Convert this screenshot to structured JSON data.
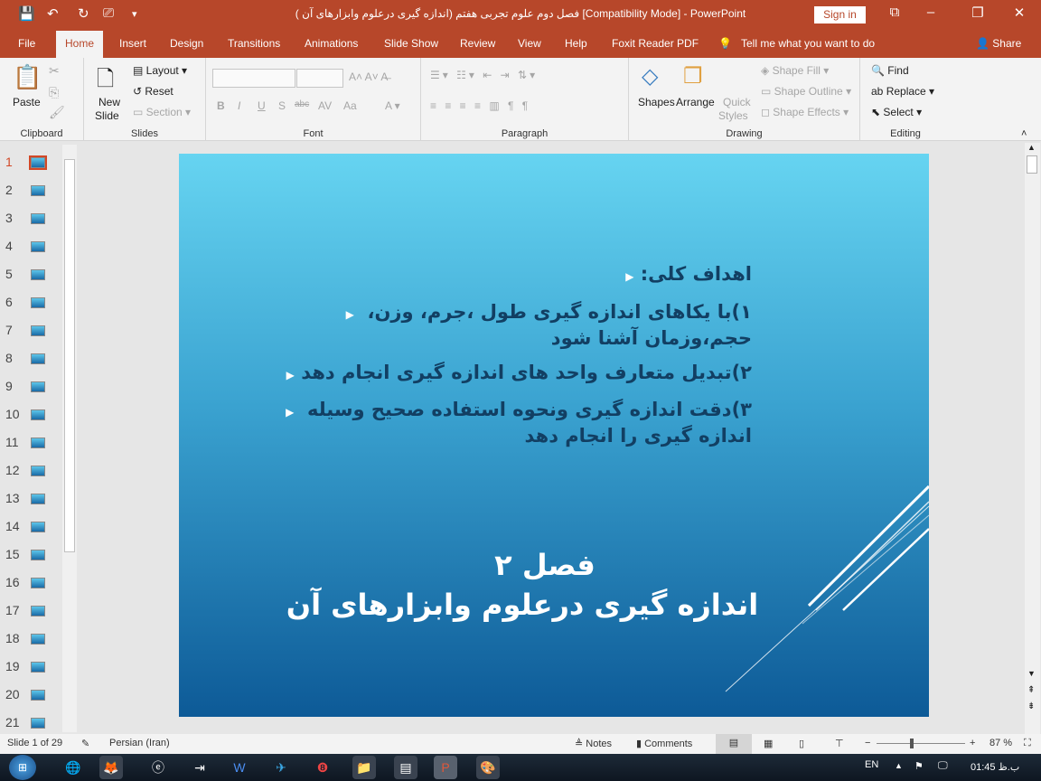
{
  "window": {
    "title": "فصل دوم علوم تجربی هفتم (اندازه گیری درعلوم وابزارهای آن ) [Compatibility Mode]  -  PowerPoint",
    "sign_in": "Sign in"
  },
  "tabs": [
    "File",
    "Home",
    "Insert",
    "Design",
    "Transitions",
    "Animations",
    "Slide Show",
    "Review",
    "View",
    "Help",
    "Foxit Reader PDF"
  ],
  "tell_me": "Tell me what you want to do",
  "share": "Share",
  "ribbon": {
    "clipboard": {
      "label": "Clipboard",
      "paste": "Paste"
    },
    "slides": {
      "label": "Slides",
      "new_slide": "New",
      "new_slide2": "Slide",
      "layout": "Layout",
      "reset": "Reset",
      "section": "Section"
    },
    "font": {
      "label": "Font"
    },
    "paragraph": {
      "label": "Paragraph"
    },
    "drawing": {
      "label": "Drawing",
      "shapes": "Shapes",
      "arrange": "Arrange",
      "quick": "Quick",
      "styles": "Styles",
      "fill": "Shape Fill",
      "outline": "Shape Outline",
      "effects": "Shape Effects"
    },
    "editing": {
      "label": "Editing",
      "find": "Find",
      "replace": "Replace",
      "select": "Select"
    }
  },
  "thumbnails": [
    "1",
    "2",
    "3",
    "4",
    "5",
    "6",
    "7",
    "8",
    "9",
    "10",
    "11",
    "12",
    "13",
    "14",
    "15",
    "16",
    "17",
    "18",
    "19",
    "20",
    "21"
  ],
  "slide": {
    "heading": "اهداف کلی:",
    "items": [
      {
        "line1": "۱)با یکاهای  اندازه گیری طول ،جرم، وزن،",
        "line2": "حجم،وزمان آشنا شود"
      },
      {
        "line1": "۲)تبدیل متعارف واحد های اندازه گیری انجام دهد",
        "line2": ""
      },
      {
        "line1": "۳)دقت اندازه گیری ونحوه استفاده صحیح وسیله",
        "line2": "اندازه گیری را انجام دهد"
      }
    ],
    "title1": "فصل ۲",
    "title2": "اندازه گیری درعلوم وابزارهای آن"
  },
  "status": {
    "slide": "Slide 1 of 29",
    "language": "Persian (Iran)",
    "notes": "Notes",
    "comments": "Comments",
    "zoom": "87 %",
    "zoom_fraction": 0.4
  },
  "taskbar": {
    "lang": "EN",
    "time": "01:45 ب.ظ"
  },
  "colors": {
    "accent": "#b7472a",
    "slide_top": "#66d4f1",
    "slide_bottom": "#0d5a97",
    "text": "#123f63"
  }
}
